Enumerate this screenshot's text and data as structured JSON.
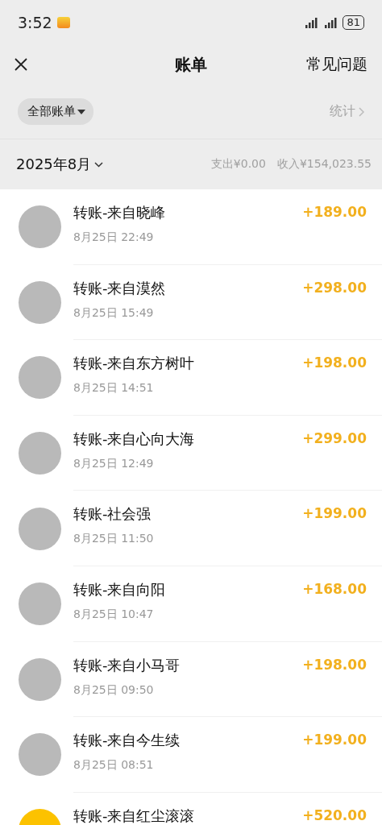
{
  "status_bar": {
    "time": "3:52",
    "battery": "81"
  },
  "header": {
    "title": "账单",
    "action": "常见问题"
  },
  "filter": {
    "label": "全部账单",
    "stats": "统计"
  },
  "month_bar": {
    "month": "2025年8月",
    "expense": "支出¥0.00",
    "income": "收入¥154,023.55"
  },
  "transactions": [
    {
      "title": "转账-来自晓峰",
      "time": "8月25日 22:49",
      "amount": "+189.00",
      "kind": "photo"
    },
    {
      "title": "转账-来自漠然",
      "time": "8月25日 15:49",
      "amount": "+298.00",
      "kind": "photo"
    },
    {
      "title": "转账-来自东方树叶",
      "time": "8月25日 14:51",
      "amount": "+198.00",
      "kind": "photo"
    },
    {
      "title": "转账-来自心向大海",
      "time": "8月25日 12:49",
      "amount": "+299.00",
      "kind": "photo"
    },
    {
      "title": "转账-社会强",
      "time": "8月25日 11:50",
      "amount": "+199.00",
      "kind": "photo"
    },
    {
      "title": "转账-来自向阳",
      "time": "8月25日 10:47",
      "amount": "+168.00",
      "kind": "photo"
    },
    {
      "title": "转账-来自小马哥",
      "time": "8月25日 09:50",
      "amount": "+198.00",
      "kind": "photo"
    },
    {
      "title": "转账-来自今生续",
      "time": "8月25日 08:51",
      "amount": "+199.00",
      "kind": "photo"
    },
    {
      "title": "转账-来自红尘滚滚",
      "amount": "+520.00",
      "kind": "coin"
    }
  ]
}
